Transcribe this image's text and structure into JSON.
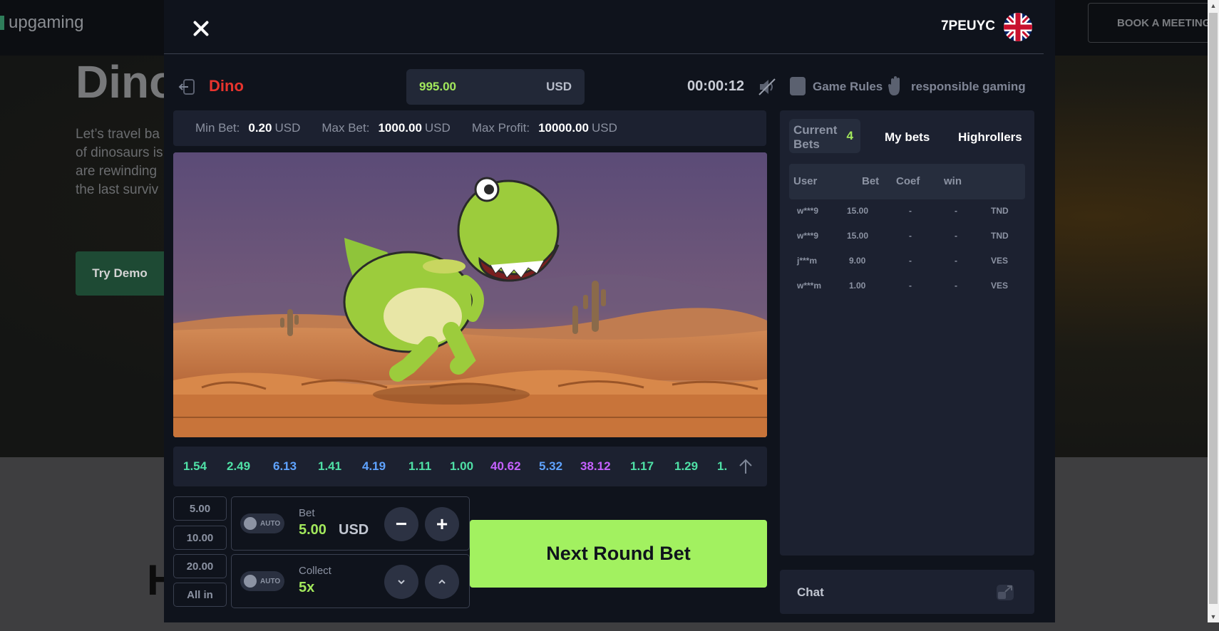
{
  "background": {
    "logo_text": "upgaming",
    "title": "Dino",
    "paragraph": [
      "Let’s travel ba",
      "of dinosaurs is",
      "are rewinding",
      "the last surviv"
    ],
    "demo_button": "Try Demo",
    "meeting_button": "BOOK A MEETING",
    "heading_fragment": "H"
  },
  "header": {
    "user_id": "7PEUYC",
    "flag_icon": "uk-flag-icon"
  },
  "game": {
    "name": "Dino",
    "balance": "995.00",
    "currency": "USD",
    "timer": "00:00:12",
    "rules_label": "Game Rules",
    "responsible_label": "responsible gaming"
  },
  "limits": {
    "min_label": "Min Bet:",
    "min_value": "0.20",
    "min_cur": "USD",
    "max_label": "Max Bet:",
    "max_value": "1000.00",
    "max_cur": "USD",
    "profit_label": "Max Profit:",
    "profit_value": "10000.00",
    "profit_cur": "USD"
  },
  "history": [
    {
      "value": "1.54",
      "color": "#4fe0a6"
    },
    {
      "value": "2.49",
      "color": "#4fe0a6"
    },
    {
      "value": "6.13",
      "color": "#5fa3ff"
    },
    {
      "value": "1.41",
      "color": "#4fe0a6"
    },
    {
      "value": "4.19",
      "color": "#5fa3ff"
    },
    {
      "value": "1.11",
      "color": "#4fe0a6"
    },
    {
      "value": "1.00",
      "color": "#4fe0a6"
    },
    {
      "value": "40.62",
      "color": "#c561ff"
    },
    {
      "value": "5.32",
      "color": "#5fa3ff"
    },
    {
      "value": "38.12",
      "color": "#c561ff"
    },
    {
      "value": "1.17",
      "color": "#4fe0a6"
    },
    {
      "value": "1.29",
      "color": "#4fe0a6"
    },
    {
      "value": "1.",
      "color": "#4fe0a6"
    }
  ],
  "quick_bets": [
    "5.00",
    "10.00",
    "20.00",
    "All in"
  ],
  "bet_panel": {
    "auto_label": "AUTO",
    "bet_label": "Bet",
    "bet_value": "5.00",
    "bet_currency": "USD",
    "minus": "−",
    "plus": "+"
  },
  "collect_panel": {
    "auto_label": "AUTO",
    "collect_label": "Collect",
    "collect_value": "5x"
  },
  "next_round_label": "Next Round Bet",
  "bets": {
    "tab_current": "Current Bets",
    "current_count": "4",
    "tab_my": "My bets",
    "tab_high": "Highrollers",
    "columns": [
      "User",
      "Bet",
      "Coef",
      "win"
    ],
    "rows": [
      {
        "user": "w***9",
        "bet": "15.00",
        "coef": "-",
        "win": "-",
        "currency": "TND"
      },
      {
        "user": "w***9",
        "bet": "15.00",
        "coef": "-",
        "win": "-",
        "currency": "TND"
      },
      {
        "user": "j***m",
        "bet": "9.00",
        "coef": "-",
        "win": "-",
        "currency": "VES"
      },
      {
        "user": "w***m",
        "bet": "1.00",
        "coef": "-",
        "win": "-",
        "currency": "VES"
      }
    ]
  },
  "chat_label": "Chat"
}
